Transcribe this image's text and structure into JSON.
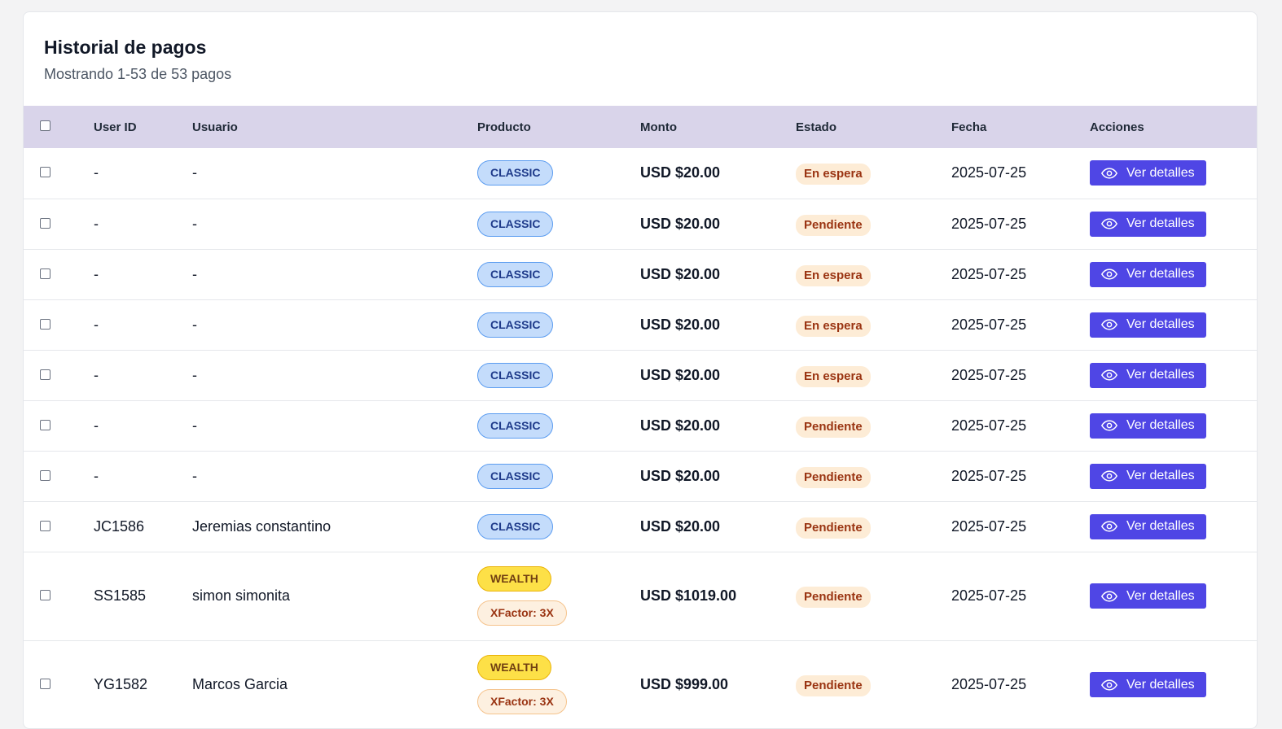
{
  "header": {
    "title": "Historial de pagos",
    "subtitle": "Mostrando 1-53 de 53 pagos"
  },
  "table": {
    "columns": [
      "",
      "User ID",
      "Usuario",
      "Producto",
      "Monto",
      "Estado",
      "Fecha",
      "Acciones"
    ],
    "action_label": "Ver detalles",
    "rows": [
      {
        "user_id": "-",
        "usuario": "-",
        "productos": [
          "CLASSIC"
        ],
        "monto": "USD $20.00",
        "estado": "En espera",
        "fecha": "2025-07-25"
      },
      {
        "user_id": "-",
        "usuario": "-",
        "productos": [
          "CLASSIC"
        ],
        "monto": "USD $20.00",
        "estado": "Pendiente",
        "fecha": "2025-07-25"
      },
      {
        "user_id": "-",
        "usuario": "-",
        "productos": [
          "CLASSIC"
        ],
        "monto": "USD $20.00",
        "estado": "En espera",
        "fecha": "2025-07-25"
      },
      {
        "user_id": "-",
        "usuario": "-",
        "productos": [
          "CLASSIC"
        ],
        "monto": "USD $20.00",
        "estado": "En espera",
        "fecha": "2025-07-25"
      },
      {
        "user_id": "-",
        "usuario": "-",
        "productos": [
          "CLASSIC"
        ],
        "monto": "USD $20.00",
        "estado": "En espera",
        "fecha": "2025-07-25"
      },
      {
        "user_id": "-",
        "usuario": "-",
        "productos": [
          "CLASSIC"
        ],
        "monto": "USD $20.00",
        "estado": "Pendiente",
        "fecha": "2025-07-25"
      },
      {
        "user_id": "-",
        "usuario": "-",
        "productos": [
          "CLASSIC"
        ],
        "monto": "USD $20.00",
        "estado": "Pendiente",
        "fecha": "2025-07-25"
      },
      {
        "user_id": "JC1586",
        "usuario": "Jeremias constantino",
        "productos": [
          "CLASSIC"
        ],
        "monto": "USD $20.00",
        "estado": "Pendiente",
        "fecha": "2025-07-25"
      },
      {
        "user_id": "SS1585",
        "usuario": "simon simonita",
        "productos": [
          "WEALTH",
          "XFactor: 3X"
        ],
        "monto": "USD $1019.00",
        "estado": "Pendiente",
        "fecha": "2025-07-25"
      },
      {
        "user_id": "YG1582",
        "usuario": "Marcos Garcia",
        "productos": [
          "WEALTH",
          "XFactor: 3X"
        ],
        "monto": "USD $999.00",
        "estado": "Pendiente",
        "fecha": "2025-07-25"
      }
    ]
  },
  "colors": {
    "accent": "#4f46e5",
    "header_bg": "#d9d4ea",
    "classic_badge": "#c4dcfb",
    "wealth_badge": "#fde047",
    "status_bg": "#fdecd6"
  },
  "icons": {
    "action": "eye-icon",
    "select": "checkbox"
  }
}
